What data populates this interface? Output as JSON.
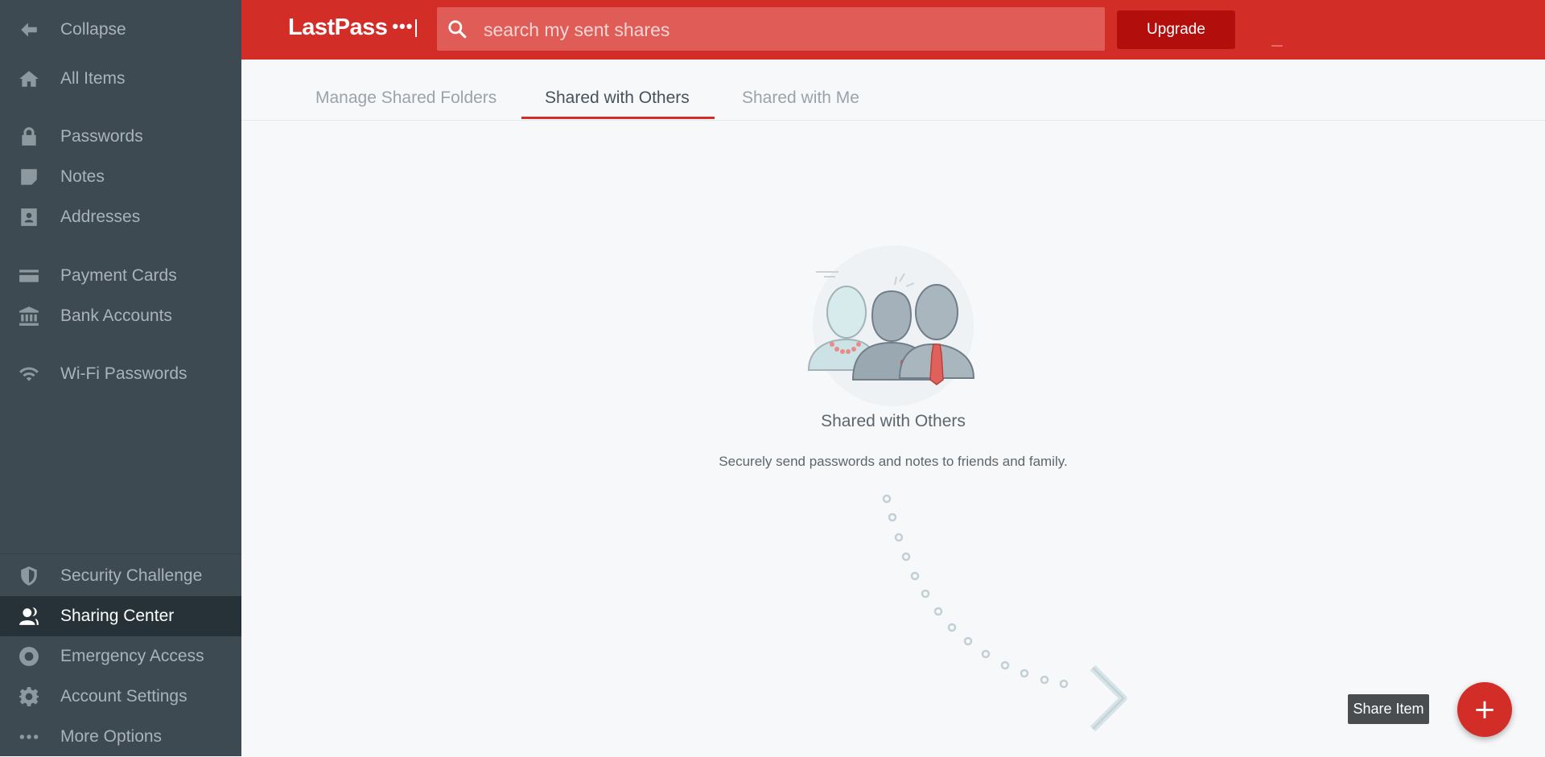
{
  "sidebar": {
    "items": [
      {
        "label": "Collapse",
        "icon": "arrow-left-icon"
      },
      {
        "label": "All Items",
        "icon": "home-icon"
      },
      {
        "label": "Passwords",
        "icon": "lock-icon"
      },
      {
        "label": "Notes",
        "icon": "note-icon"
      },
      {
        "label": "Addresses",
        "icon": "address-book-icon"
      },
      {
        "label": "Payment Cards",
        "icon": "credit-card-icon"
      },
      {
        "label": "Bank Accounts",
        "icon": "bank-icon"
      },
      {
        "label": "Wi-Fi Passwords",
        "icon": "wifi-icon"
      },
      {
        "label": "Security Challenge",
        "icon": "shield-icon"
      },
      {
        "label": "Sharing Center",
        "icon": "person-share-icon",
        "active": true
      },
      {
        "label": "Emergency Access",
        "icon": "lifebuoy-icon"
      },
      {
        "label": "Account Settings",
        "icon": "gear-icon"
      },
      {
        "label": "More Options",
        "icon": "more-dots-icon"
      }
    ]
  },
  "header": {
    "logo_text": "LastPass",
    "logo_dots": "•••",
    "search_placeholder": "search my sent shares",
    "upgrade_label": "Upgrade"
  },
  "tabs": [
    {
      "label": "Manage Shared Folders",
      "active": false
    },
    {
      "label": "Shared with Others",
      "active": true
    },
    {
      "label": "Shared with Me",
      "active": false
    }
  ],
  "empty_state": {
    "title": "Shared with Others",
    "description": "Securely send passwords and notes to friends and family."
  },
  "share_item": {
    "tooltip": "Share Item",
    "fab_label": "+"
  },
  "colors": {
    "brand_red": "#d32d27",
    "sidebar_bg": "#3d4a52",
    "sidebar_active_bg": "#273238",
    "upgrade_bg": "#b20f0c"
  }
}
